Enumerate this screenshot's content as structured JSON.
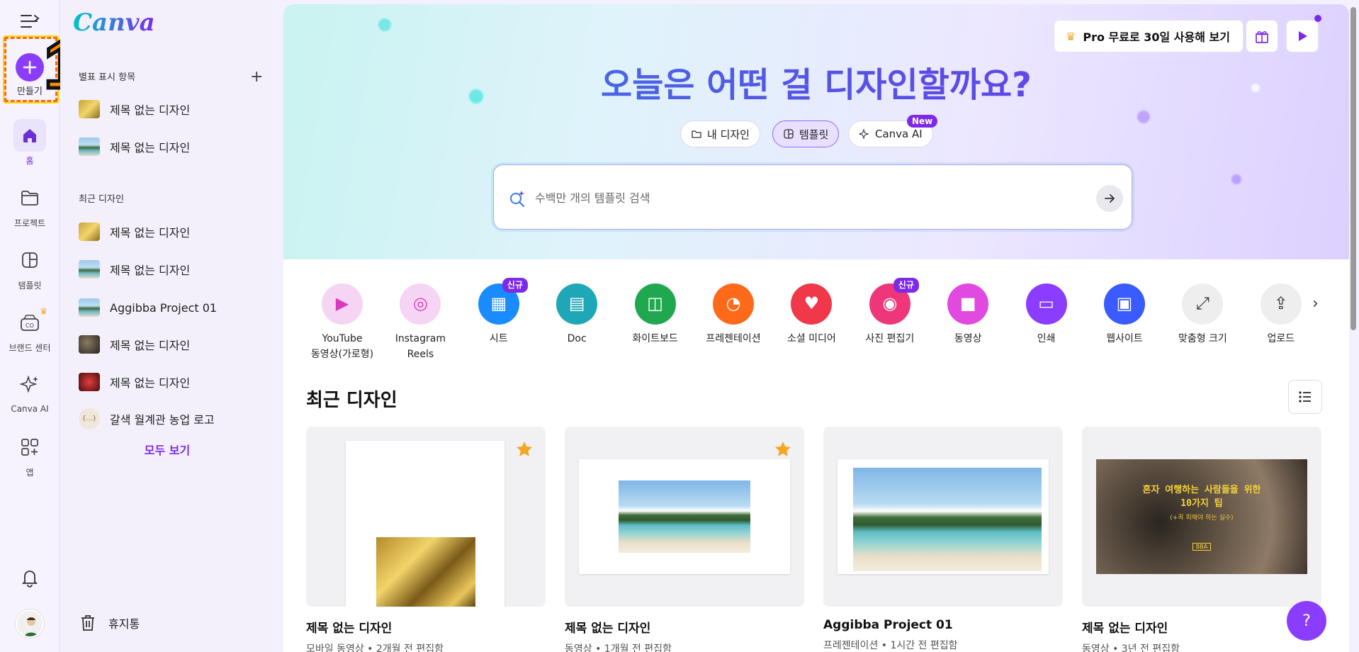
{
  "rail": {
    "create_label": "만들기",
    "step_number": "1",
    "items": [
      {
        "label": "홈",
        "icon": "home-icon"
      },
      {
        "label": "프로젝트",
        "icon": "folder-icon"
      },
      {
        "label": "템플릿",
        "icon": "template-icon"
      },
      {
        "label": "브랜드 센터",
        "icon": "brand-icon"
      },
      {
        "label": "Canva AI",
        "icon": "sparkle-icon"
      },
      {
        "label": "앱",
        "icon": "apps-icon"
      }
    ]
  },
  "panel": {
    "logo": "Canva",
    "starred_title": "별표 표시 항목",
    "starred": [
      "제목 없는 디자인",
      "제목 없는 디자인"
    ],
    "recent_title": "최근 디자인",
    "recent": [
      "제목 없는 디자인",
      "제목 없는 디자인",
      "Aggibba Project 01",
      "제목 없는 디자인",
      "제목 없는 디자인",
      "갈색 월계관 농업 로고"
    ],
    "see_all": "모두 보기",
    "trash": "휴지통"
  },
  "header": {
    "pro_label": "Pro 무료로 30일 사용해 보기",
    "title": "오늘은 어떤 걸 디자인할까요?",
    "pills": [
      "내 디자인",
      "템플릿",
      "Canva AI"
    ],
    "new_badge": "New"
  },
  "search": {
    "placeholder": "수백만 개의 템플릿 검색"
  },
  "categories": [
    {
      "label": "YouTube\n동영상(가로형)",
      "color": "#f6d4f4",
      "icon_color": "#d83bbd"
    },
    {
      "label": "Instagram\nReels",
      "color": "#f6d4f4",
      "icon_color": "#d83bbd"
    },
    {
      "label": "시트",
      "color": "#1a8cff",
      "badge": "신규"
    },
    {
      "label": "Doc",
      "color": "#1ea7b6"
    },
    {
      "label": "화이트보드",
      "color": "#1fa84f"
    },
    {
      "label": "프레젠테이션",
      "color": "#ff6a1a"
    },
    {
      "label": "소셜 미디어",
      "color": "#f0384a"
    },
    {
      "label": "사진 편집기",
      "color": "#f0367a",
      "badge": "신규"
    },
    {
      "label": "동영상",
      "color": "#e04ae0"
    },
    {
      "label": "인쇄",
      "color": "#8b3dff"
    },
    {
      "label": "웹사이트",
      "color": "#3a5bff"
    },
    {
      "label": "맞춤형 크기",
      "color": "#eeeeee"
    },
    {
      "label": "업로드",
      "color": "#eeeeee"
    }
  ],
  "recent": {
    "title": "최근 디자인",
    "cards": [
      {
        "name": "제목 없는 디자인",
        "meta": "모바일 동영상 • 2개월 전 편집함"
      },
      {
        "name": "제목 없는 디자인",
        "meta": "동영상 • 1개월 전 편집함"
      },
      {
        "name": "Aggibba Project 01",
        "meta": "프레젠테이션 • 1시간 전 편집함"
      },
      {
        "name": "제목 없는 디자인",
        "meta": "동영상 • 3년 전 편집함"
      }
    ],
    "card4_title": "혼자 여행하는 사람들을 위한\n10가지 팁",
    "card4_subtitle": "(+꼭 피해야 하는 실수)",
    "card4_tag": "BBA"
  },
  "help_label": "?",
  "colors": {
    "accent": "#8b3dff",
    "star": "#f5a623"
  }
}
